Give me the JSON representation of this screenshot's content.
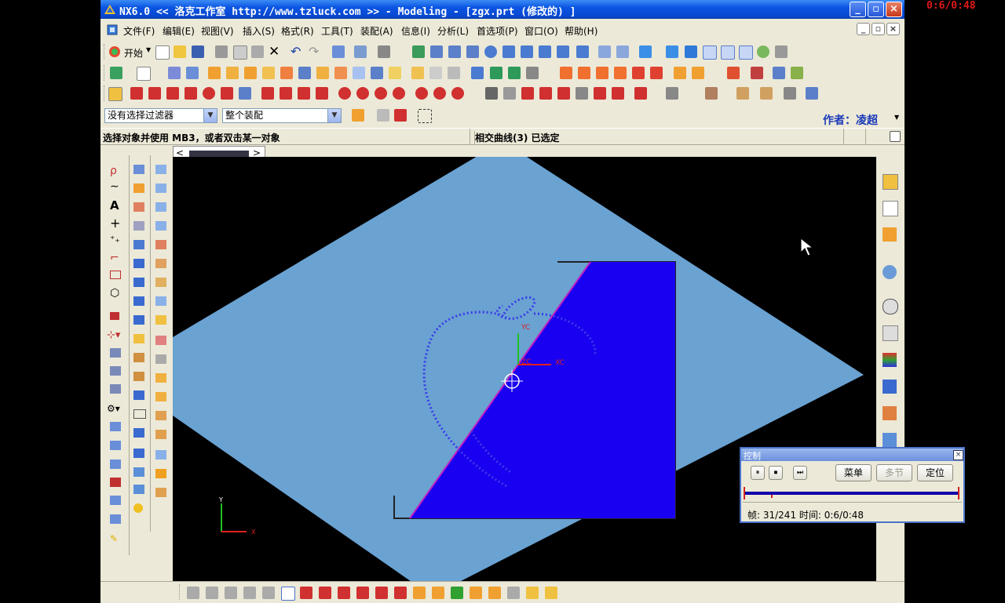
{
  "overlay_timer": "0:6/0:48",
  "window": {
    "title": "NX6.0  << 洛克工作室  http://www.tzluck.com >> - Modeling - [zgx.prt (修改的) ]",
    "controls": [
      "_",
      "□",
      "×"
    ]
  },
  "menu": {
    "items": [
      "文件(F)",
      "编辑(E)",
      "视图(V)",
      "插入(S)",
      "格式(R)",
      "工具(T)",
      "装配(A)",
      "信息(I)",
      "分析(L)",
      "首选项(P)",
      "窗口(O)",
      "帮助(H)"
    ],
    "start_label": "开始"
  },
  "toolbar": {
    "filter_value": "没有选择过滤器",
    "scope_value": "整个装配",
    "author_label": "作者：",
    "author_name": "凌超"
  },
  "cue": {
    "left": "选择对象并使用 MB3，或者双击某一对象",
    "right": "相交曲线(3) 已选定"
  },
  "viewport": {
    "wcs_labels": {
      "yc": "YC",
      "xc": "XC",
      "zc": "ZC"
    },
    "abs_labels": {
      "y": "Y",
      "x": "X"
    },
    "colors": {
      "plane": "#6aa2d2",
      "solid": "#1a00f0",
      "curve": "#3a3ae8",
      "edge": "#b020b0"
    }
  },
  "control_dialog": {
    "title": "控制",
    "buttons": {
      "menu": "菜单",
      "step": "多节",
      "locate": "定位"
    },
    "status": "帧: 31/241  时间: 0:6/0:48",
    "progress": 0.128
  }
}
